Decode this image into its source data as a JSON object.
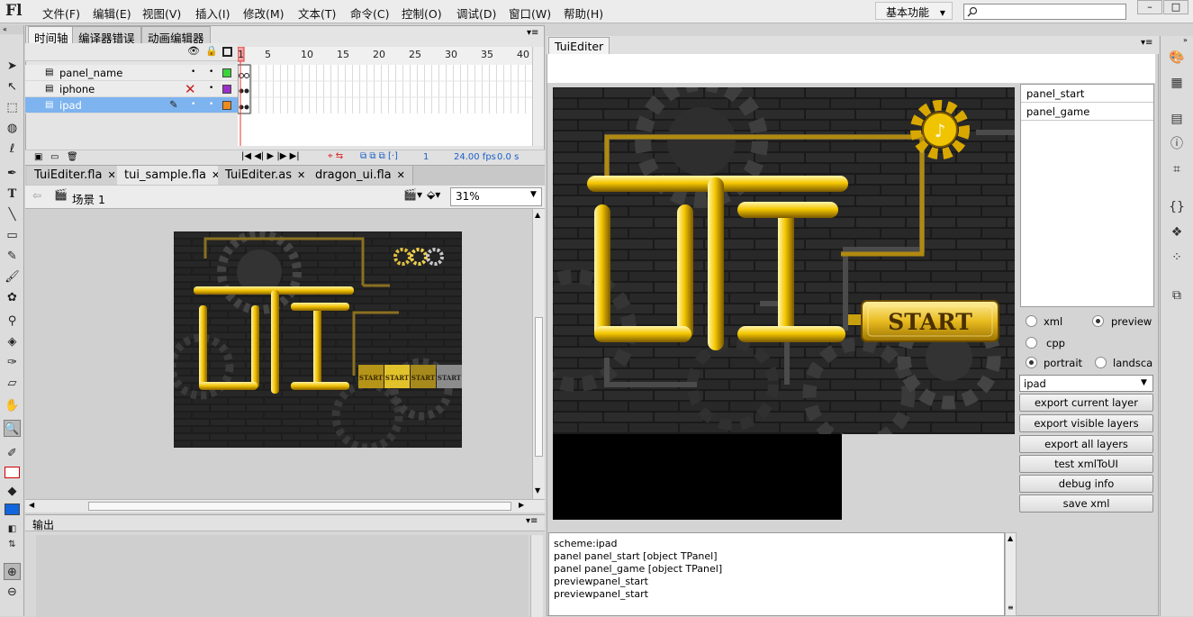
{
  "app": {
    "logo": "Fl"
  },
  "menu": [
    "文件(F)",
    "编辑(E)",
    "视图(V)",
    "插入(I)",
    "修改(M)",
    "文本(T)",
    "命令(C)",
    "控制(O)",
    "调试(D)",
    "窗口(W)",
    "帮助(H)"
  ],
  "workspace": {
    "label": "基本功能",
    "arrow": "▾"
  },
  "window_buttons": [
    "–",
    "□"
  ],
  "timeline": {
    "tabs": [
      "时间轴",
      "编译器错误",
      "动画编辑器"
    ],
    "frame_numbers": [
      "1",
      "5",
      "10",
      "15",
      "20",
      "25",
      "30",
      "35",
      "40"
    ],
    "layers": [
      {
        "name": "panel_name",
        "color": "#3cd23c",
        "dots": [
          "•",
          "•"
        ]
      },
      {
        "name": "iphone",
        "color": "#9b2fc7",
        "dots": [
          "✕",
          "•"
        ]
      },
      {
        "name": "ipad",
        "color": "#ef8a1c",
        "dots": [
          "•",
          "•"
        ],
        "selected": true
      }
    ],
    "status": {
      "frame": "1",
      "fps": "24.00 fps",
      "time": "0.0 s"
    },
    "controls": "|◀ ◀| ▶ |▶ ▶|"
  },
  "doc_tabs": [
    {
      "label": "TuiEditer.fla",
      "active": false
    },
    {
      "label": "tui_sample.fla",
      "active": true
    },
    {
      "label": "TuiEditer.as",
      "active": false
    },
    {
      "label": "dragon_ui.fla",
      "active": false
    }
  ],
  "tab_close": "✕",
  "scene": {
    "label": "场景 1",
    "zoom": "31%"
  },
  "output": {
    "title": "输出"
  },
  "tui": {
    "title": "TuiEditer",
    "panels": [
      "panel_start",
      "panel_game"
    ],
    "radios": [
      {
        "label": "xml",
        "checked": false
      },
      {
        "label": "preview",
        "checked": true
      },
      {
        "label": "cpp",
        "checked": false
      },
      {
        "label": "portrait",
        "checked": true
      },
      {
        "label": "landscap",
        "checked": false
      }
    ],
    "scheme": "ipad",
    "buttons": [
      "export current layer",
      "export visible layers",
      "export all layers",
      "test xmlToUI",
      "debug info",
      "save xml"
    ],
    "log": [
      "scheme:ipad",
      "panel panel_start [object TPanel]",
      "panel panel_game [object TPanel]",
      "previewpanel_start",
      "previewpanel_start"
    ],
    "start_label": "START",
    "small_start_labels": [
      "START",
      "START",
      "START",
      "START"
    ]
  }
}
